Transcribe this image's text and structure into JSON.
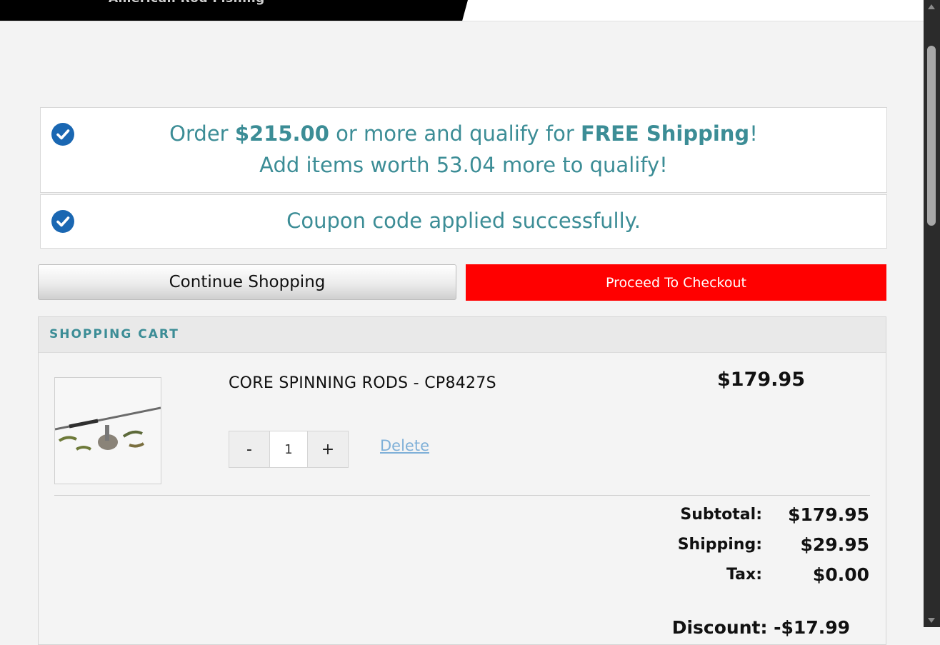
{
  "header": {
    "brand": "American Rod Fishing"
  },
  "notices": {
    "shipping_prefix": "Order ",
    "shipping_amount": "$215.00",
    "shipping_middle": " or more and qualify for ",
    "shipping_free": "FREE Shipping",
    "shipping_suffix": "!",
    "shipping_remaining": "Add items worth 53.04 more to qualify!",
    "coupon": "Coupon code applied successfully."
  },
  "buttons": {
    "continue": "Continue Shopping",
    "checkout": "Proceed To Checkout"
  },
  "cart": {
    "title": "SHOPPING CART",
    "item": {
      "name": "CORE SPINNING RODS - CP8427S",
      "price": "$179.95",
      "qty_minus": "-",
      "qty": "1",
      "qty_plus": "+",
      "delete": "Delete"
    },
    "totals": [
      {
        "label": "Subtotal:",
        "value": "$179.95"
      },
      {
        "label": "Shipping:",
        "value": "$29.95"
      },
      {
        "label": "Tax:",
        "value": "$0.00"
      }
    ],
    "discount": "Discount: -$17.99"
  },
  "colors": {
    "accent_teal": "#3c8d96",
    "checkout_red": "#ff0000",
    "check_blue": "#1a67b2",
    "link_blue": "#7fb0d8"
  }
}
